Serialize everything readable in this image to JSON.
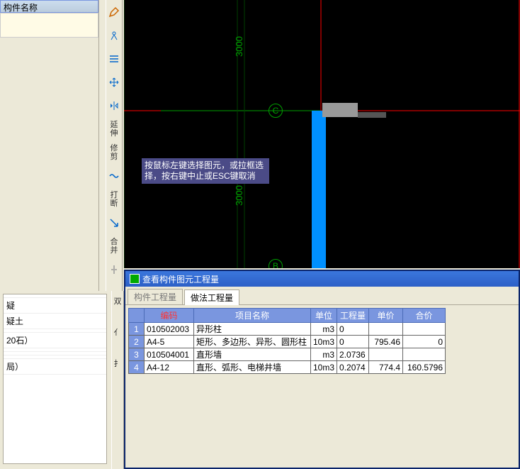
{
  "leftPanel": {
    "header": "构件名称"
  },
  "toolbar": {
    "items": [
      {
        "label": "",
        "icon": "pencil-icon"
      },
      {
        "label": "",
        "icon": "compass-icon"
      },
      {
        "label": "",
        "icon": "align-icon"
      },
      {
        "label": "",
        "icon": "move-icon"
      },
      {
        "label": "",
        "icon": "mirror-icon"
      },
      {
        "label": "延伸",
        "icon": "extend-icon"
      },
      {
        "label": "修剪",
        "icon": "trim-icon"
      },
      {
        "label": "",
        "icon": "break-icon"
      },
      {
        "label": "打断",
        "icon": "cut-icon"
      },
      {
        "label": "",
        "icon": "arrow-icon"
      },
      {
        "label": "合并",
        "icon": "merge-icon"
      },
      {
        "label": "",
        "icon": "split-icon"
      }
    ]
  },
  "canvas": {
    "hint": "按鼠标左键选择图元，或拉框选择，按右键中止或ESC键取消",
    "gridC": "C",
    "gridB": "B",
    "dim1": "3000",
    "dim2": "3000"
  },
  "resultWindow": {
    "title": "查看构件图元工程量",
    "tabs": [
      {
        "label": "构件工程量",
        "active": false
      },
      {
        "label": "做法工程量",
        "active": true
      }
    ],
    "columns": [
      "编码",
      "项目名称",
      "单位",
      "工程量",
      "单价",
      "合价"
    ],
    "rows": [
      {
        "idx": "1",
        "code": "010502003",
        "name": "异形柱",
        "unit": "m3",
        "qty": "0",
        "price": "",
        "total": ""
      },
      {
        "idx": "2",
        "code": "A4-5",
        "name": "矩形、多边形、异形、圆形柱",
        "unit": "10m3",
        "qty": "0",
        "price": "795.46",
        "total": "0"
      },
      {
        "idx": "3",
        "code": "010504001",
        "name": "直形墙",
        "unit": "m3",
        "qty": "2.0736",
        "price": "",
        "total": ""
      },
      {
        "idx": "4",
        "code": "A4-12",
        "name": "直形、弧形、电梯井墙",
        "unit": "10m3",
        "qty": "0.2074",
        "price": "774.4",
        "total": "160.5796"
      }
    ]
  },
  "leftBottom": {
    "items": [
      "",
      "疑",
      "疑土",
      "",
      "20石）",
      "",
      "",
      "",
      "局）"
    ]
  },
  "sideToolCol": {
    "items": [
      "双",
      "",
      "亻",
      "",
      "扌"
    ]
  }
}
